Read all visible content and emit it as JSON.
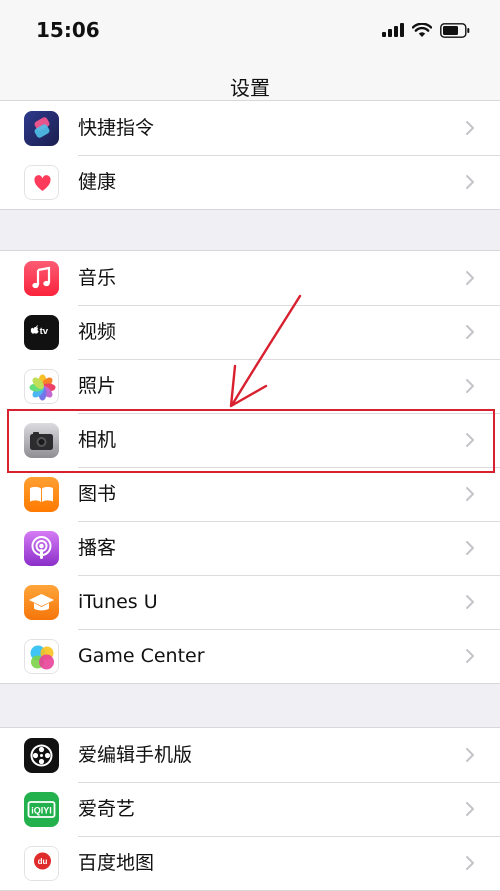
{
  "status": {
    "time": "15:06"
  },
  "nav": {
    "title": "设置"
  },
  "groups": [
    {
      "items": [
        {
          "label": "快捷指令",
          "icon": "shortcuts-icon"
        },
        {
          "label": "健康",
          "icon": "health-icon"
        }
      ]
    },
    {
      "items": [
        {
          "label": "音乐",
          "icon": "music-icon"
        },
        {
          "label": "视频",
          "icon": "tv-icon",
          "icon_text": "tv"
        },
        {
          "label": "照片",
          "icon": "photos-icon"
        },
        {
          "label": "相机",
          "icon": "camera-icon"
        },
        {
          "label": "图书",
          "icon": "books-icon"
        },
        {
          "label": "播客",
          "icon": "podcasts-icon"
        },
        {
          "label": "iTunes U",
          "icon": "itunes-u-icon"
        },
        {
          "label": "Game Center",
          "icon": "game-center-icon"
        }
      ]
    },
    {
      "items": [
        {
          "label": "爱编辑手机版",
          "icon": "film-reel-icon"
        },
        {
          "label": "爱奇艺",
          "icon": "iqiyi-icon",
          "icon_text": "iQIYI"
        },
        {
          "label": "百度地图",
          "icon": "baidu-map-icon",
          "icon_text": "du"
        }
      ]
    }
  ],
  "colors": {
    "annotation": "#d8202f",
    "background": "#efeff4",
    "chevron": "#c4c4c9"
  }
}
